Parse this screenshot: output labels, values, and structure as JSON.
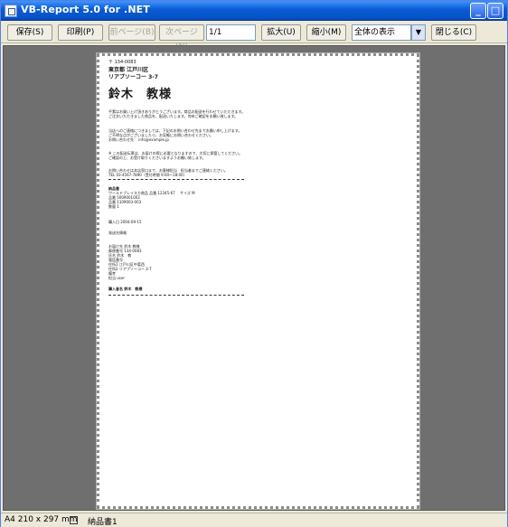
{
  "window": {
    "title": "VB-Report 5.0 for .NET"
  },
  "toolbar": {
    "save": "保存(S)",
    "print": "印刷(P)",
    "prev_page": "前ページ(B)",
    "next_page": "次ページ(N)",
    "page_value": "1/1",
    "zoom_in": "拡大(U)",
    "zoom_out": "縮小(M)",
    "zoom_value": "全体の表示",
    "close": "閉じる(C)"
  },
  "document": {
    "postal": "〒 134-0083",
    "addr1": "東京都 江戸川区",
    "addr2": "リアプソーコー 3-7",
    "name": "鈴木　教様",
    "para1": [
      "平素はお買い上げ頂きありがとうございます。商品の配送を行わせていただきます。",
      "ご注文いただきました商品を、配送いたします。何卒ご確認をお願い致します。"
    ],
    "para2": [
      "当店へのご連絡につきましては、下記のお問い合わせ先までお願い申し上げます。",
      "ご不明な点がございましたら、お気軽にお問い合わせください。",
      "お問い合わせ先： info@example.jp"
    ],
    "para3": [
      "※ この配送伝票は、お届けの際に必要となりますので、大切に保管してください。",
      "ご確認の上、お受け取りくださいますようお願い致します。"
    ],
    "contact_line1": "お問い合わせは本店窓口まで、お客様担当　担当者までご連絡ください。",
    "contact_line2": "TEL 03-4567-7890（受付時間 9:00〜18:00）",
    "items_title": "納品書",
    "items": [
      "ワールドプレイスカ商品 品番 12345-67 　サイズ M",
      "品番 5009001003",
      "品番 1109003-003",
      "数量 1"
    ],
    "date": "購入日 2004-09-15",
    "shipping": "発送先情報",
    "contact_title": "お届け先 鈴木 教様",
    "contact": [
      "郵便番号 134-0083",
      "氏名 鈴木　教",
      "電話番号",
      "住所1 江戸川区中葛西",
      "住所2 リアプソーコー 3-7",
      "備考",
      "担当 user"
    ],
    "signature": "購入者名 鈴木　教様"
  },
  "status": {
    "paper_size": "A4 210 x 297 mm",
    "sheet_name": "納品書1"
  }
}
